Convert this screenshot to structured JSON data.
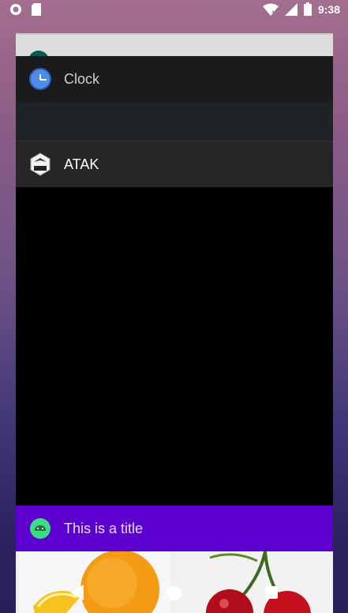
{
  "status_bar": {
    "time": "9:38",
    "left_icons": [
      "record-icon",
      "sd-card-icon"
    ],
    "right_icons": [
      "wifi-icon",
      "signal-icon",
      "battery-icon"
    ]
  },
  "recents": {
    "cards": [
      {
        "app": "Clock",
        "icon": "clock-icon"
      },
      {
        "app": "ATAK",
        "icon": "atak-icon"
      },
      {
        "app": "This is a title",
        "icon": "android-icon",
        "accent": "#5c00d0"
      }
    ]
  },
  "nav_bar": {
    "buttons": [
      "back-icon",
      "home-icon",
      "recents-icon"
    ]
  },
  "colors": {
    "title_bar": "#5c00d0",
    "card_dark": "#262626",
    "clock_blue": "#4d8de8"
  }
}
